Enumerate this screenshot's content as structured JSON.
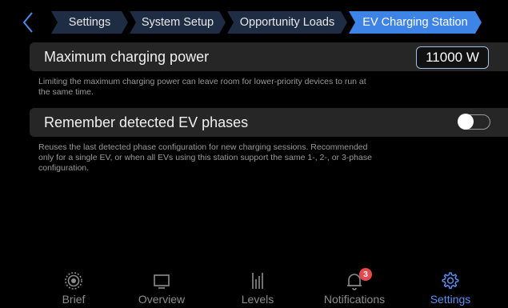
{
  "breadcrumb": {
    "items": [
      {
        "label": "Settings"
      },
      {
        "label": "System Setup"
      },
      {
        "label": "Opportunity Loads"
      },
      {
        "label": "EV Charging Station"
      }
    ]
  },
  "settings": {
    "max_power": {
      "label": "Maximum charging power",
      "value": "11000 W",
      "description": "Limiting the maximum charging power can leave room for lower-priority devices to run at the same time."
    },
    "remember_phases": {
      "label": "Remember detected EV phases",
      "enabled": false,
      "description": "Reuses the last detected phase configuration for new charging sessions. Recommended only for a single EV, or when all EVs using this station support the same 1-, 2-, or 3-phase configuration."
    }
  },
  "bottom_nav": {
    "items": [
      {
        "label": "Brief",
        "icon": "brief-icon"
      },
      {
        "label": "Overview",
        "icon": "overview-icon"
      },
      {
        "label": "Levels",
        "icon": "levels-icon"
      },
      {
        "label": "Notifications",
        "icon": "bell-icon",
        "badge": "3"
      },
      {
        "label": "Settings",
        "icon": "gear-icon",
        "active": true
      }
    ]
  },
  "colors": {
    "crumb_fill": "#1f2d44",
    "crumb_active_fill": "#3e83e6",
    "accent": "#5b8ff0",
    "badge": "#e5484d"
  }
}
